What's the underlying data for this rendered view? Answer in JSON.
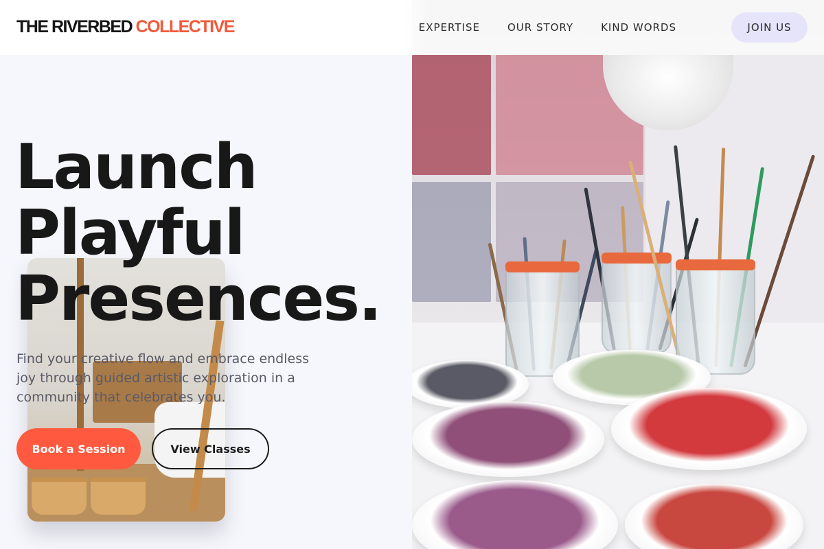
{
  "brand": {
    "name_part1": "THE RIVERBED",
    "name_part2": "COLLECTIVE",
    "accent_color": "#f05a3c"
  },
  "nav": {
    "links": [
      "EXPERTISE",
      "OUR STORY",
      "KIND WORDS"
    ],
    "cta_label": "JOIN US"
  },
  "hero": {
    "headline_lines": [
      "Launch",
      "Playful",
      "Presences."
    ],
    "subtext": "Find your creative flow and embrace endless joy through guided artistic exploration in a community that celebrates you.",
    "primary_button": "Book a Session",
    "secondary_button": "View Classes"
  },
  "colors": {
    "primary_button_bg": "#ff5a3f",
    "join_button_bg": "#e6e4fb",
    "page_bg": "#f6f7fc"
  }
}
